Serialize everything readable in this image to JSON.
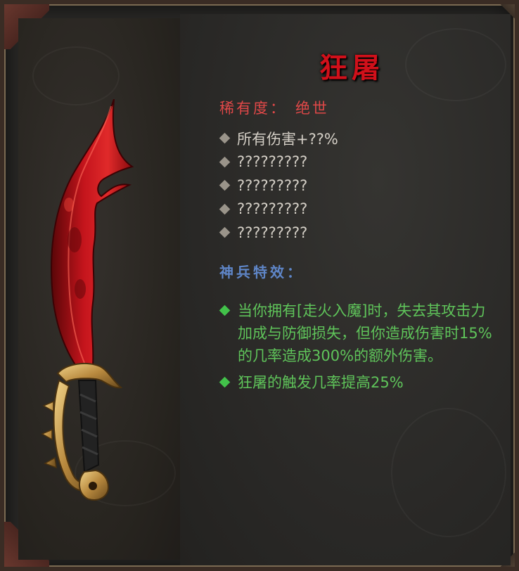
{
  "item": {
    "name": "狂屠",
    "rarity_label": "稀有度：",
    "rarity_value": "绝世",
    "stats": [
      "所有伤害+??%",
      "?????????",
      "?????????",
      "?????????",
      "?????????"
    ],
    "effects_title": "神兵特效：",
    "effects": [
      "当你拥有[走火入魔]时，失去其攻击力加成与防御损失，但你造成伤害时15%的几率造成300%的额外伤害。",
      "狂屠的触发几率提高25%"
    ]
  },
  "colors": {
    "title": "#d0101a",
    "rarity": "#e04848",
    "stat_text": "#d4cfc6",
    "effects_title": "#5f86c8",
    "effect_text": "#5fc45a"
  },
  "icons": {
    "weapon": "crimson-dagger-icon",
    "bullet": "diamond-bullet-icon",
    "effect_bullet": "green-diamond-bullet-icon"
  }
}
